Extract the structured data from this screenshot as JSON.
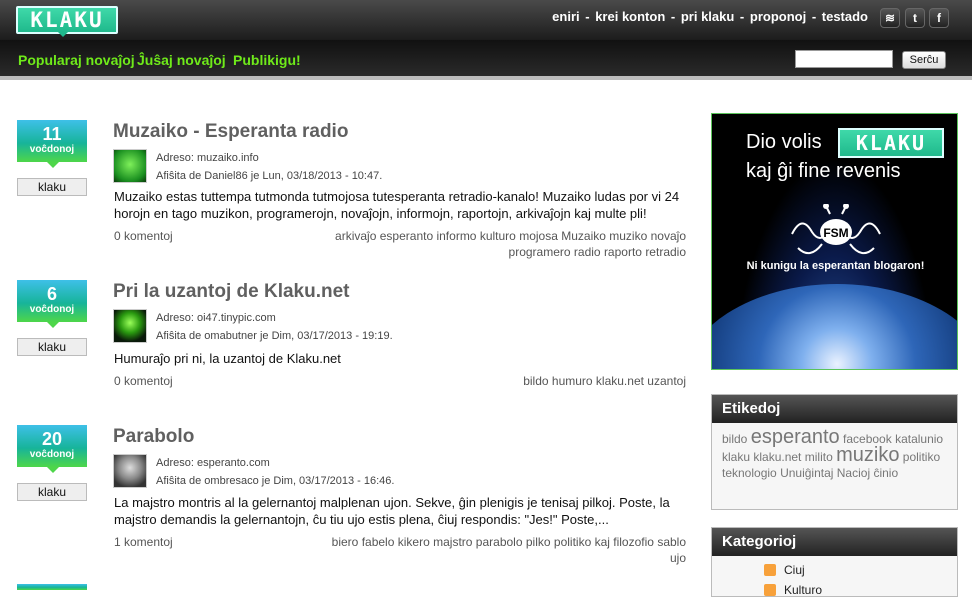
{
  "header": {
    "logo": "KLAKU",
    "links": [
      "eniri",
      "krei konton",
      "pri klaku",
      "proponoj",
      "testado"
    ],
    "social": [
      {
        "icon": "rss-icon",
        "glyph": "≋"
      },
      {
        "icon": "twitter-icon",
        "glyph": "t"
      },
      {
        "icon": "facebook-icon",
        "glyph": "f"
      }
    ]
  },
  "nav": {
    "items": [
      "Popularaj novaĵoj",
      "Ĵuŝaj novaĵoj",
      "Publikigu!"
    ],
    "search_button": "Serĉu",
    "search_value": ""
  },
  "entries": [
    {
      "votes": "11",
      "votes_label": "voĉdonoj",
      "vote_button": "klaku",
      "title": "Muzaiko - Esperanta radio",
      "address": "Adreso: muzaiko.info",
      "posted": "Afiŝita de Daniel86 je Lun, 03/18/2013 - 10:47.",
      "body": "Muzaiko estas tuttempa tutmonda tutmojosa tutesperanta retradio-kanalo! Muzaiko ludas por vi 24 horojn en tago muzikon, programerojn, novaĵojn, informojn, raportojn, arkivaĵojn kaj multe pli!",
      "comments": "0 komentoj",
      "tags": [
        "arkivaĵo",
        "esperanto",
        "informo",
        "kulturo",
        "mojosa",
        "Muzaiko",
        "muziko",
        "novaĵo",
        "programero",
        "radio",
        "raporto",
        "retradio"
      ]
    },
    {
      "votes": "6",
      "votes_label": "voĉdonoj",
      "vote_button": "klaku",
      "title": "Pri la uzantoj de Klaku.net",
      "address": "Adreso: oi47.tinypic.com",
      "posted": "Afiŝita de omabutner je Dim, 03/17/2013 - 19:19.",
      "body": "Humuraĵo pri ni, la uzantoj de Klaku.net",
      "comments": "0 komentoj",
      "tags": [
        "bildo",
        "humuro",
        "klaku.net",
        "uzantoj"
      ]
    },
    {
      "votes": "20",
      "votes_label": "voĉdonoj",
      "vote_button": "klaku",
      "title": "Parabolo",
      "address": "Adreso: esperanto.com",
      "posted": "Afiŝita de ombresaco je Dim, 03/17/2013 - 16:46.",
      "body": "La majstro montris al la gelernantoj malplenan ujon. Sekve, ĝin plenigis je tenisaj pilkoj. Poste, la majstro demandis la gelernantojn, ĉu tiu ujo estis plena, ĉiuj respondis: \"Jes!\" Poste,...",
      "comments": "1 komentoj",
      "tags": [
        "biero",
        "fabelo",
        "kikero",
        "majstro",
        "parabolo",
        "pilko",
        "politiko",
        "kaj filozofio",
        "sablo",
        "ujo"
      ]
    }
  ],
  "banner": {
    "line1": "Dio volis",
    "logo": "KLAKU",
    "line2": "kaj ĝi fine revenis",
    "fsm": "FSM",
    "tagline": "Ni kunigu la esperantan blogaron!"
  },
  "tag_box": {
    "title": "Etikedoj",
    "tags": [
      {
        "text": "bildo",
        "big": false
      },
      {
        "text": "esperanto",
        "big": true
      },
      {
        "text": "facebook",
        "big": false
      },
      {
        "text": "katalunio",
        "big": false
      },
      {
        "text": "klaku",
        "big": false
      },
      {
        "text": "klaku.net",
        "big": false
      },
      {
        "text": "milito",
        "big": false
      },
      {
        "text": "muziko",
        "big": true
      },
      {
        "text": "politiko",
        "big": false
      },
      {
        "text": "teknologio",
        "big": false
      },
      {
        "text": "Unuiĝintaj Nacioj",
        "big": false
      },
      {
        "text": "ĉinio",
        "big": false
      }
    ]
  },
  "category_box": {
    "title": "Kategorioj",
    "items": [
      "Ciuj",
      "Kulturo"
    ]
  },
  "colors": {
    "accent_green": "#6fea1a",
    "vote_top": "#3ec0e8",
    "vote_bottom": "#4ed64a"
  }
}
